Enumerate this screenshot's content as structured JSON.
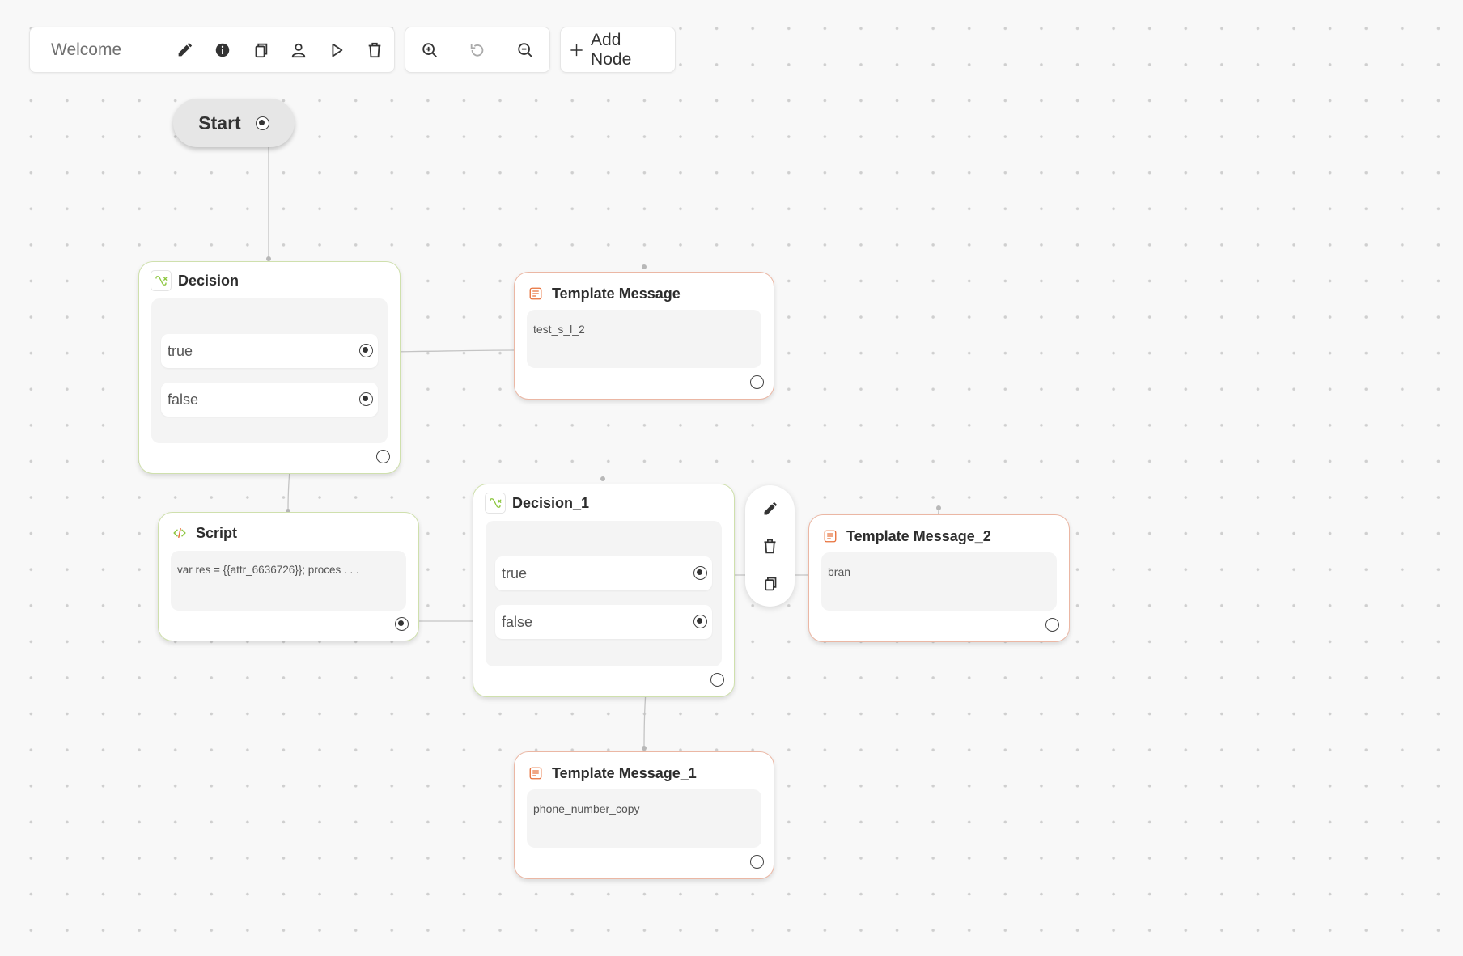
{
  "toolbar": {
    "title": "Welcome",
    "actions": [
      "pencil-icon",
      "info-icon",
      "copy-icon",
      "user-icon",
      "play-icon",
      "trash-icon"
    ],
    "zoom": [
      "zoom-in-icon",
      "reset-icon",
      "zoom-out-icon"
    ],
    "add_node_label": "Add Node"
  },
  "flow": {
    "start_label": "Start",
    "decision": {
      "title": "Decision",
      "branches": [
        "true",
        "false"
      ]
    },
    "template_message": {
      "title": "Template Message",
      "content": "test_s_l_2"
    },
    "script": {
      "title": "Script",
      "content": "var res = {{attr_6636726}}; proces . . ."
    },
    "decision_1": {
      "title": "Decision_1",
      "branches": [
        "true",
        "false"
      ]
    },
    "template_message_1": {
      "title": "Template Message_1",
      "content": "phone_number_copy"
    },
    "template_message_2": {
      "title": "Template Message_2",
      "content": "bran"
    },
    "node_menu": [
      "edit-icon",
      "delete-icon",
      "duplicate-icon"
    ]
  },
  "colors": {
    "decision_accent": "#8cc63f",
    "template_accent": "#e8703a",
    "canvas_background": "#f8f8f8"
  }
}
